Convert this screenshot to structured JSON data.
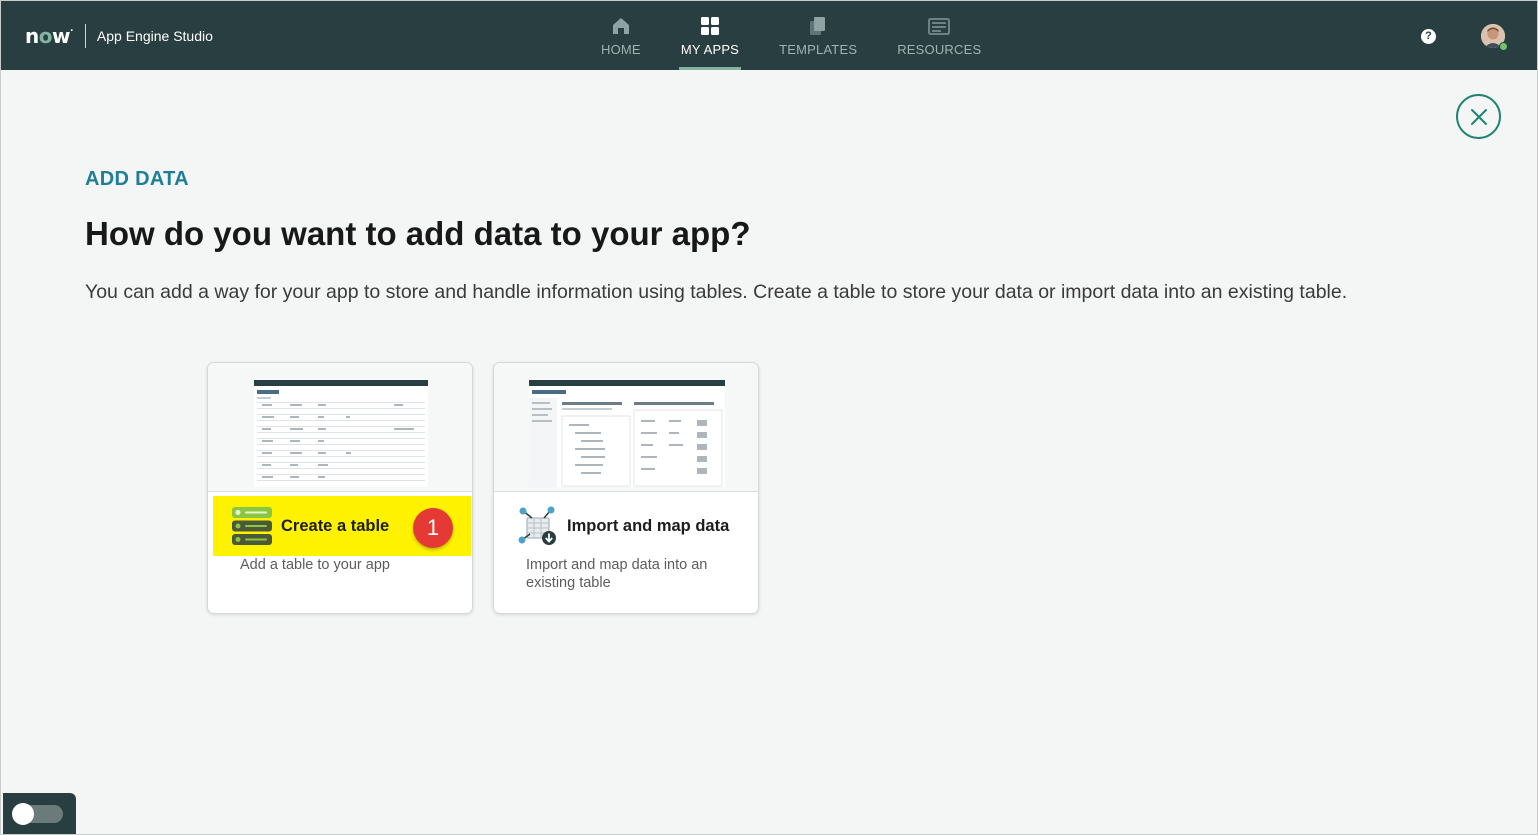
{
  "header": {
    "logo": "now",
    "app_name": "App Engine Studio",
    "nav": [
      {
        "label": "HOME",
        "icon": "home-icon",
        "active": false
      },
      {
        "label": "MY APPS",
        "icon": "grid-icon",
        "active": true
      },
      {
        "label": "TEMPLATES",
        "icon": "templates-icon",
        "active": false
      },
      {
        "label": "RESOURCES",
        "icon": "resources-icon",
        "active": false
      }
    ],
    "help_label": "?",
    "avatar_icon": "user-avatar-icon"
  },
  "main": {
    "eyebrow": "ADD DATA",
    "title": "How do you want to add data to your app?",
    "description": "You can add a way for your app to store and handle information using tables. Create a table to store your data or import data into an existing table.",
    "close_icon": "close-icon"
  },
  "options": [
    {
      "title": "Create a table",
      "description": "Add a table to your app",
      "icon": "database-table-icon",
      "highlighted": true,
      "step_badge": "1"
    },
    {
      "title": "Import and map data",
      "description": "Import and map data into an existing table",
      "icon": "import-map-icon",
      "highlighted": false
    }
  ],
  "colors": {
    "topbar": "#293e40",
    "accent": "#81b5a1",
    "eyebrow": "#1f7f96",
    "highlight": "#fff200",
    "badge": "#e53935"
  }
}
